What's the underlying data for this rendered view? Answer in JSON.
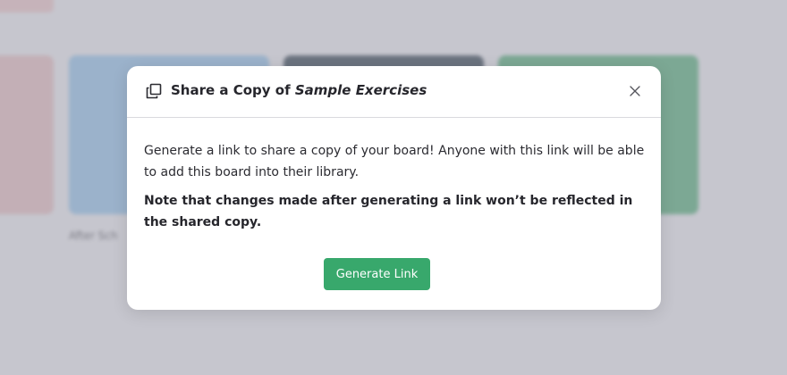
{
  "background": {
    "card_label": "After Sch"
  },
  "modal": {
    "title_prefix": "Share a Copy of ",
    "title_board": "Sample Exercises",
    "description": "Generate a link to share a copy of your board! Anyone with this link will be able to add this board into their library.",
    "note": "Note that changes made after generating a link won’t be reflected in the shared copy.",
    "generate_button": "Generate Link",
    "icons": {
      "title_icon": "copy-icon",
      "close_icon": "close-icon"
    }
  },
  "colors": {
    "accent": "#38a86c",
    "divider": "#d9d9de",
    "text": "#26262c"
  }
}
